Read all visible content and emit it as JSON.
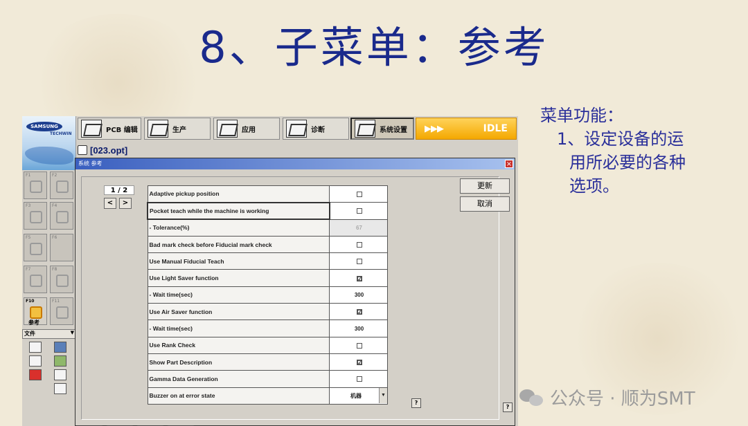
{
  "slide": {
    "title": "8、子菜单：参考",
    "notes_heading": "菜单功能：",
    "notes_item_1": "1、设定设备的运",
    "notes_item_2": "用所必要的各种",
    "notes_item_3": "选项。"
  },
  "watermark": "公众号 · 顺为SMT",
  "app": {
    "brand": "SAMSUNG",
    "brand_sub": "TECHWIN",
    "toolbar": [
      {
        "label": "PCB 编辑",
        "icon": "pcb-edit-icon"
      },
      {
        "label": "生产",
        "icon": "production-icon"
      },
      {
        "label": "应用",
        "icon": "application-icon"
      },
      {
        "label": "诊断",
        "icon": "diagnostics-icon"
      },
      {
        "label": "系统设置",
        "icon": "system-settings-icon"
      }
    ],
    "status": "IDLE",
    "status_arrows": "▶▶▶",
    "file_name": "[023.opt]",
    "fkeys": {
      "f10_label": "F10",
      "f10_name": "参考"
    },
    "file_panel": "文件"
  },
  "dialog": {
    "title": "系统 参考",
    "page_indicator": "1 / 2",
    "prev": "<",
    "next": ">",
    "buttons": {
      "update": "更新",
      "cancel": "取消"
    },
    "help": "?",
    "options": [
      {
        "label": "Adaptive pickup position",
        "value": ""
      },
      {
        "label": "Pocket teach while the machine is working",
        "value": ""
      },
      {
        "label": " - Tolerance(%)",
        "value": "67"
      },
      {
        "label": "Bad mark check before Fiducial mark check",
        "value": ""
      },
      {
        "label": "Use Manual Fiducial Teach",
        "value": ""
      },
      {
        "label": "Use Light Saver function",
        "value": "☑"
      },
      {
        "label": " - Wait time(sec)",
        "value": "300"
      },
      {
        "label": "Use Air Saver function",
        "value": "☑"
      },
      {
        "label": " - Wait time(sec)",
        "value": "300"
      },
      {
        "label": "Use Rank Check",
        "value": ""
      },
      {
        "label": "Show Part Description",
        "value": "☑"
      },
      {
        "label": "Gamma Data Generation",
        "value": ""
      },
      {
        "label": "Buzzer on at error state",
        "value": "机器"
      }
    ]
  }
}
